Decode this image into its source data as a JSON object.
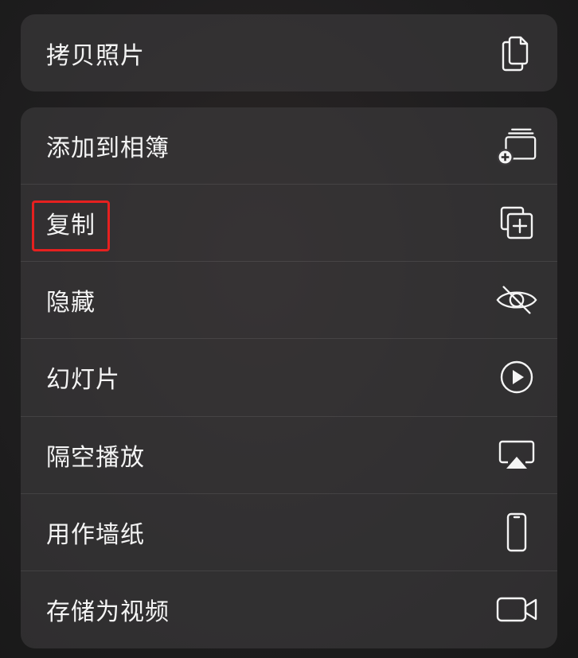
{
  "menu_top": {
    "items": [
      {
        "label": "拷贝照片",
        "icon": "copy-photo-icon"
      }
    ]
  },
  "menu_main": {
    "items": [
      {
        "label": "添加到相簿",
        "icon": "add-to-album-icon"
      },
      {
        "label": "复制",
        "icon": "duplicate-icon",
        "highlighted": true
      },
      {
        "label": "隐藏",
        "icon": "eye-slash-icon"
      },
      {
        "label": "幻灯片",
        "icon": "play-circle-icon"
      },
      {
        "label": "隔空播放",
        "icon": "airplay-icon"
      },
      {
        "label": "用作墙纸",
        "icon": "phone-icon"
      },
      {
        "label": "存储为视频",
        "icon": "video-camera-icon"
      }
    ]
  },
  "colors": {
    "highlight": "#e6201f",
    "text": "#f4f4f4"
  }
}
